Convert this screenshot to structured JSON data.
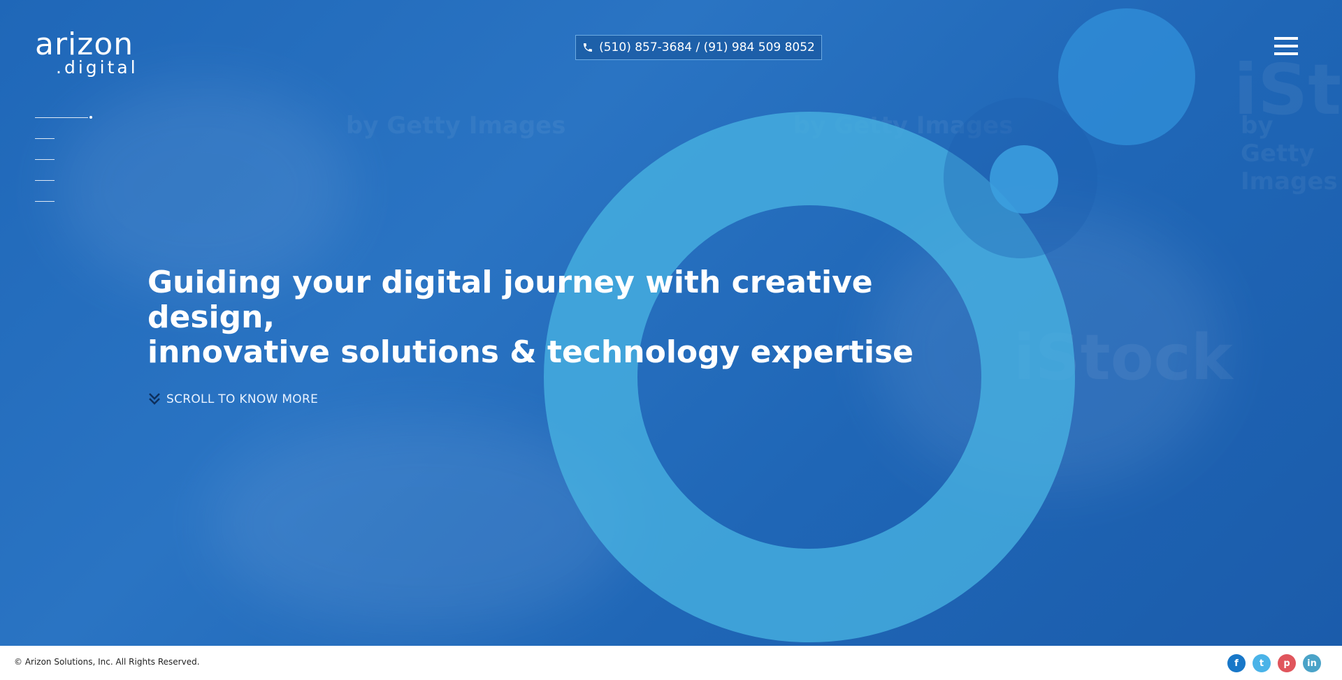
{
  "brand": {
    "logo_main": "arizon",
    "logo_sub": ".digital"
  },
  "header": {
    "phone_text": "(510) 857-3684 / (91) 984 509 8052",
    "phone_icon": "phone-icon",
    "menu_icon": "hamburger-menu-icon"
  },
  "slider": {
    "indicator_count": 5,
    "active_index": 0
  },
  "hero": {
    "headline_line1": "Guiding your digital journey with creative design,",
    "headline_line2": "innovative solutions & technology expertise",
    "scroll_label": "SCROLL TO KNOW MORE",
    "scroll_icon": "double-chevron-down-icon"
  },
  "watermark": {
    "text": "iStock",
    "subtext": "by Getty Images"
  },
  "footer": {
    "copyright": "© Arizon Solutions, Inc. All Rights Reserved.",
    "socials": [
      {
        "name": "facebook",
        "glyph": "f",
        "color": "#1877c8"
      },
      {
        "name": "twitter",
        "glyph": "t",
        "color": "#4ab3e8"
      },
      {
        "name": "pinterest",
        "glyph": "p",
        "color": "#e0555c"
      },
      {
        "name": "linkedin",
        "glyph": "in",
        "color": "#4aa3c8"
      }
    ]
  },
  "colors": {
    "hero_background": "#1f67b8",
    "ring": "#48b2e2",
    "footer_background": "#ffffff"
  }
}
